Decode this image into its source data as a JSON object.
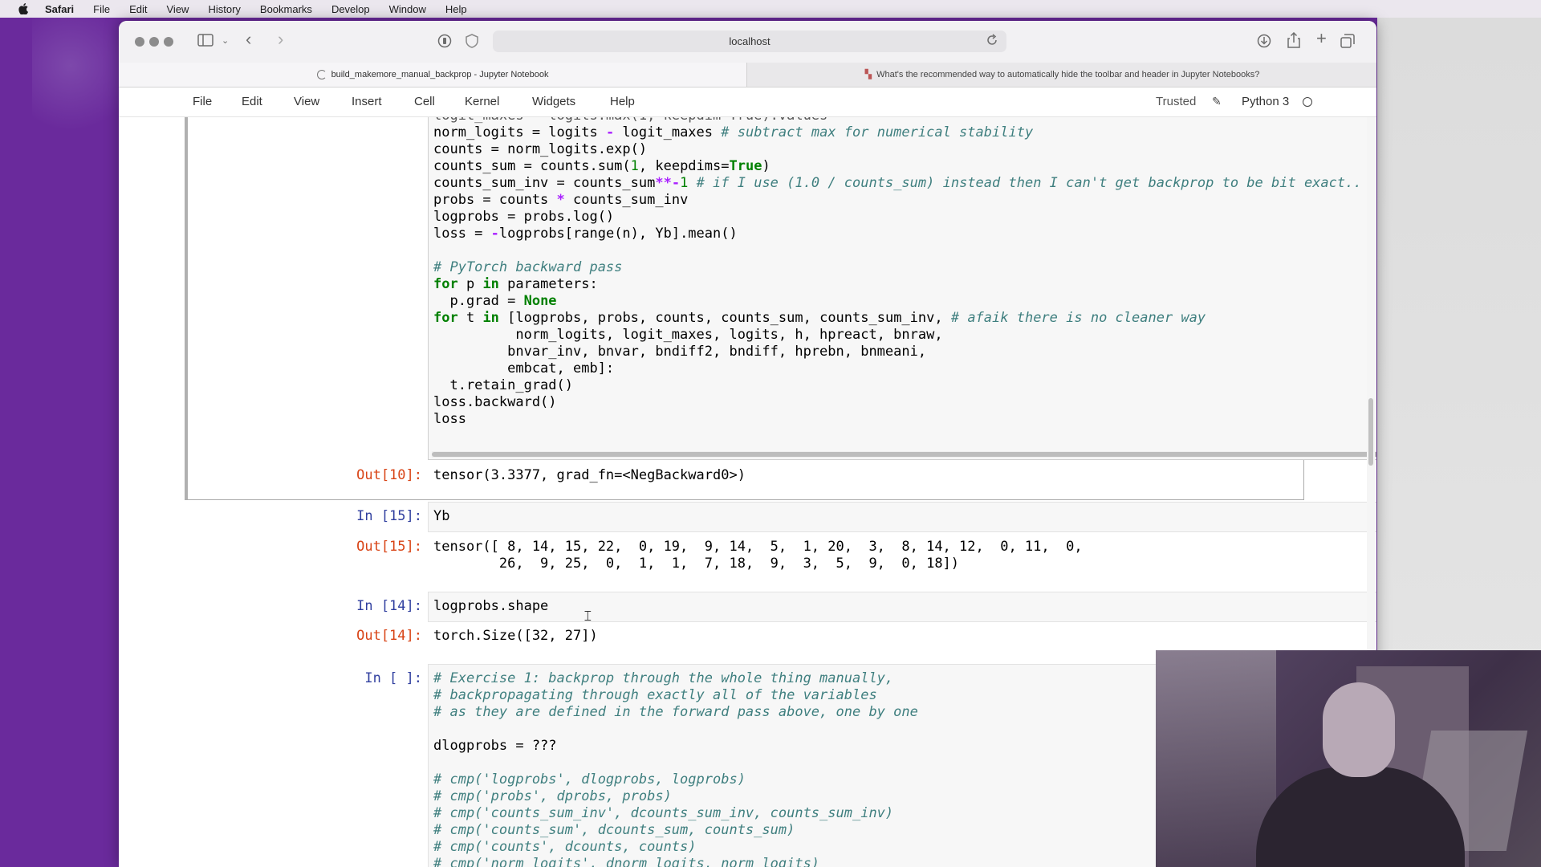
{
  "menubar": {
    "items": [
      "Safari",
      "File",
      "Edit",
      "View",
      "History",
      "Bookmarks",
      "Develop",
      "Window",
      "Help"
    ]
  },
  "browser": {
    "url": "localhost",
    "tab_active": "build_makemore_manual_backprop - Jupyter Notebook",
    "tab_other": "What's the recommended way to automatically hide the toolbar and header in Jupyter Notebooks?"
  },
  "jupyter": {
    "menu": [
      "File",
      "Edit",
      "View",
      "Insert",
      "Cell",
      "Kernel",
      "Widgets",
      "Help"
    ],
    "trusted": "Trusted",
    "kernel": "Python 3"
  },
  "cells": {
    "cell10": {
      "out_prompt": "Out[10]:",
      "output": "tensor(3.3377, grad_fn=<NegBackward0>)"
    },
    "cell15": {
      "in_prompt": "In [15]:",
      "code": "Yb",
      "out_prompt": "Out[15]:",
      "output_line1": "tensor([ 8, 14, 15, 22,  0, 19,  9, 14,  5,  1, 20,  3,  8, 14, 12,  0, 11,  0,",
      "output_line2": "        26,  9, 25,  0,  1,  1,  7, 18,  9,  3,  5,  9,  0, 18])"
    },
    "cell14": {
      "in_prompt": "In [14]:",
      "code": "logprobs.shape",
      "out_prompt": "Out[14]:",
      "output": "torch.Size([32, 27])"
    },
    "cell_new": {
      "in_prompt": "In [ ]:"
    }
  },
  "colors": {
    "desktop": "#6a2a9c",
    "prompt_in": "#303f9f",
    "prompt_out": "#d84315",
    "comment": "#3f7f7f",
    "keyword": "#008000"
  }
}
